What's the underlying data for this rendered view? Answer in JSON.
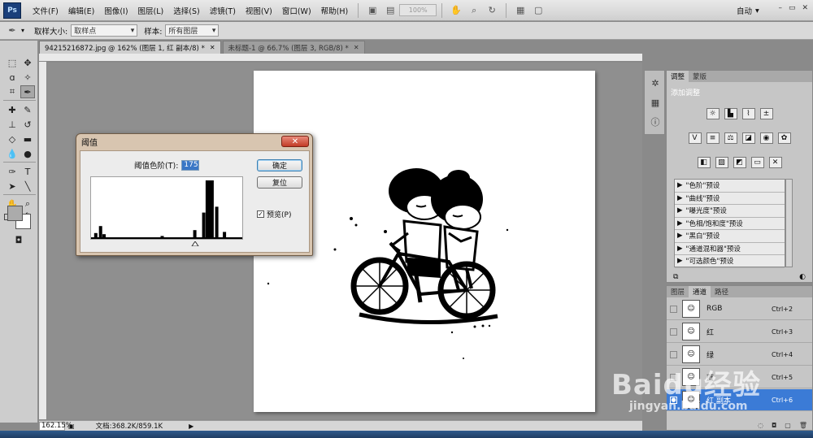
{
  "app": {
    "logo": "Ps"
  },
  "menu": {
    "items": [
      "文件(F)",
      "编辑(E)",
      "图像(I)",
      "图层(L)",
      "选择(S)",
      "滤镜(T)",
      "视图(V)",
      "窗口(W)",
      "帮助(H)"
    ],
    "zoom": "100%",
    "workspace": "自动",
    "window_controls": [
      "–",
      "▭",
      "✕"
    ]
  },
  "options": {
    "sample_size_label": "取样大小:",
    "sample_size_value": "取样点",
    "sample_label": "样本:",
    "sample_value": "所有图层"
  },
  "tabs": [
    {
      "label": "94215216872.jpg @ 162% (图层 1, 红 副本/8) *",
      "active": true
    },
    {
      "label": "未标题-1 @ 66.7% (图层 3, RGB/8) *",
      "active": false
    }
  ],
  "dialog": {
    "title": "阈值",
    "close": "✕",
    "threshold_label": "阈值色阶(T):",
    "threshold_value": "175",
    "ok": "确定",
    "reset": "复位",
    "preview_label": "预览(P)",
    "preview_checked": "✓",
    "histogram_peaks": [
      {
        "level": 8,
        "height": 0.1
      },
      {
        "level": 16,
        "height": 0.22
      },
      {
        "level": 22,
        "height": 0.08
      },
      {
        "level": 120,
        "height": 0.05
      },
      {
        "level": 175,
        "height": 0.15
      },
      {
        "level": 190,
        "height": 0.45
      },
      {
        "level": 200,
        "height": 1.0
      },
      {
        "level": 212,
        "height": 0.55
      },
      {
        "level": 225,
        "height": 0.12
      }
    ]
  },
  "adjustments": {
    "tabs": [
      "调整",
      "蒙版"
    ],
    "subtitle": "添加调整",
    "presets": [
      "\"色阶\"预设",
      "\"曲线\"预设",
      "\"曝光度\"预设",
      "\"色相/饱和度\"预设",
      "\"黑白\"预设",
      "\"通道混和器\"预设",
      "\"可选颜色\"预设"
    ]
  },
  "channels": {
    "tabs": [
      "图层",
      "通道",
      "路径"
    ],
    "rows": [
      {
        "name": "RGB",
        "shortcut": "Ctrl+2",
        "selected": false
      },
      {
        "name": "红",
        "shortcut": "Ctrl+3",
        "selected": false
      },
      {
        "name": "绿",
        "shortcut": "Ctrl+4",
        "selected": false
      },
      {
        "name": "蓝",
        "shortcut": "Ctrl+5",
        "selected": false
      },
      {
        "name": "红 副本",
        "shortcut": "Ctrl+6",
        "selected": true
      }
    ]
  },
  "status": {
    "zoom": "162.15%",
    "doc_info": "文档:368.2K/859.1K"
  },
  "watermark": {
    "logo": "Baidu经验",
    "url": "jingyan.baidu.com"
  }
}
